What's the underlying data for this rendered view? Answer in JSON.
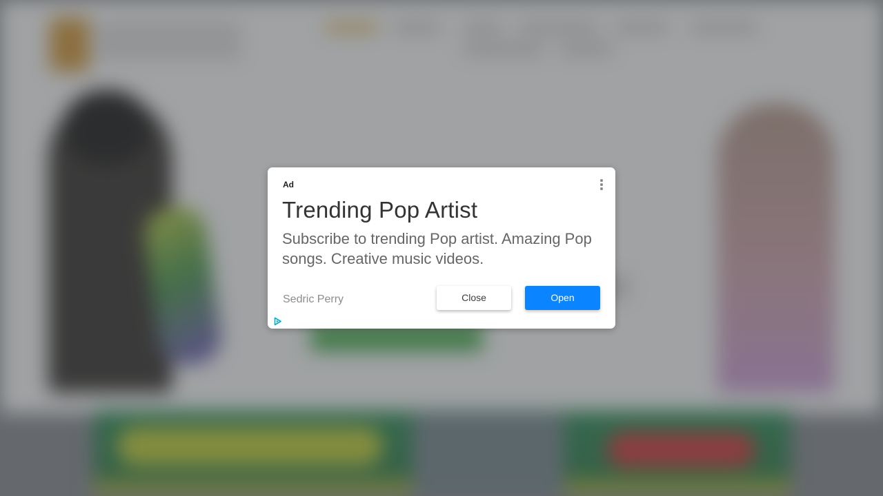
{
  "ad": {
    "label": "Ad",
    "headline": "Trending Pop Artist",
    "body": "Subscribe to trending Pop artist. Amazing Pop songs. Creative music videos.",
    "advertiser": "Sedric Perry",
    "close_label": "Close",
    "open_label": "Open",
    "menu_icon": "more-vert-icon",
    "adchoices_icon": "adchoices-icon",
    "accent_color": "#0a84ff"
  },
  "background": {
    "state": "blurred webpage behind modal overlay"
  }
}
